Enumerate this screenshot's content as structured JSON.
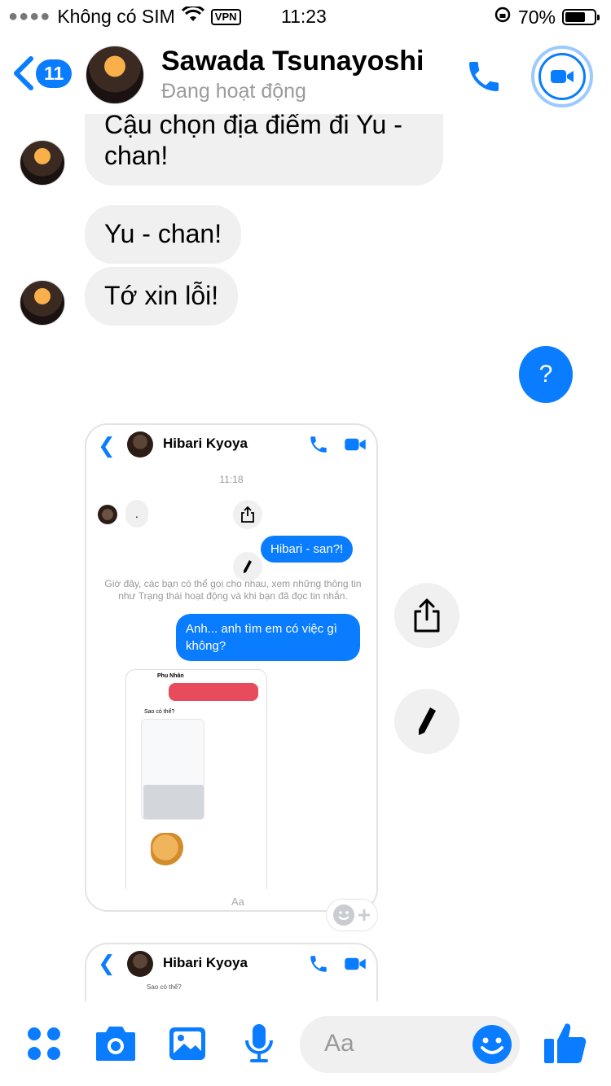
{
  "status_bar": {
    "carrier": "Không có SIM",
    "vpn": "VPN",
    "time": "11:23",
    "battery": "70%",
    "battery_level": 0.7
  },
  "header": {
    "unread_count": "11",
    "contact_name": "Sawada Tsunayoshi",
    "contact_status": "Đang hoạt động"
  },
  "messages": {
    "incoming_1": "Cậu chọn địa điểm đi Yu - chan!",
    "incoming_2": "Yu - chan!",
    "incoming_3": "Tớ xin lỗi!",
    "outgoing_1": "?"
  },
  "shared_screenshot": {
    "contact_name": "Hibari Kyoya",
    "time": "11:18",
    "incoming_dot": ".",
    "outgoing_1": "Hibari - san?!",
    "system_notice": "Giờ đây, các bạn có thể gọi cho nhau, xem những thông tin như Trạng thái hoạt động và khi bạn đã đọc tin nhắn.",
    "outgoing_2": "Anh... anh tìm em có việc gì không?",
    "nested_contact": "Phu Nhân",
    "nested_message": "Sao có thể?",
    "composer_placeholder": "Aa"
  },
  "shared_screenshot_2": {
    "contact_name": "Hibari Kyoya",
    "nested_message": "Sao có thể?"
  },
  "composer": {
    "placeholder": "Aa"
  },
  "colors": {
    "accent": "#0a7cff",
    "bubble_in": "#f0f0f0"
  }
}
